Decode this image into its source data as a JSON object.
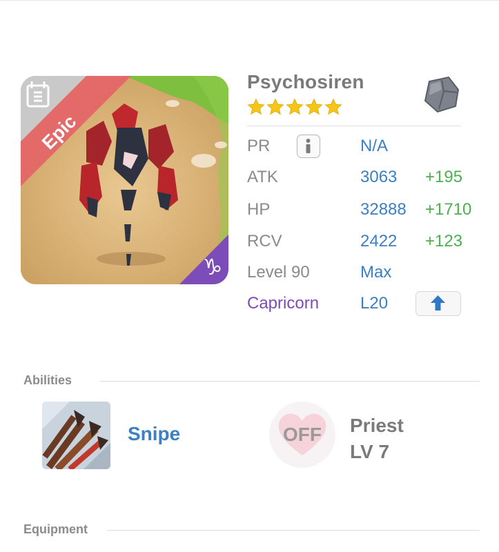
{
  "unit": {
    "name": "Psychosiren",
    "rarity": "Epic",
    "star_count": 5,
    "element_icon": "rock-element-icon",
    "zodiac_icon": "capricorn-icon"
  },
  "stats": {
    "pr": {
      "label": "PR",
      "value": "N/A"
    },
    "atk": {
      "label": "ATK",
      "value": "3063",
      "bonus": "+195"
    },
    "hp": {
      "label": "HP",
      "value": "32888",
      "bonus": "+1710"
    },
    "rcv": {
      "label": "RCV",
      "value": "2422",
      "bonus": "+123"
    },
    "level": {
      "label": "Level 90",
      "value": "Max"
    },
    "zodiac": {
      "label": "Capricorn",
      "value": "L20"
    }
  },
  "sections": {
    "abilities_title": "Abilities",
    "equipment_title": "Equipment"
  },
  "abilities": {
    "skill_name": "Snipe",
    "support_state": "OFF",
    "support_name": "Priest",
    "support_level": "LV 7"
  },
  "colors": {
    "stat_value": "#3b7fc4",
    "stat_bonus": "#4caf50",
    "zodiac": "#7c4db8",
    "rarity_banner": "#e46a6a",
    "star": "#f5c518"
  }
}
